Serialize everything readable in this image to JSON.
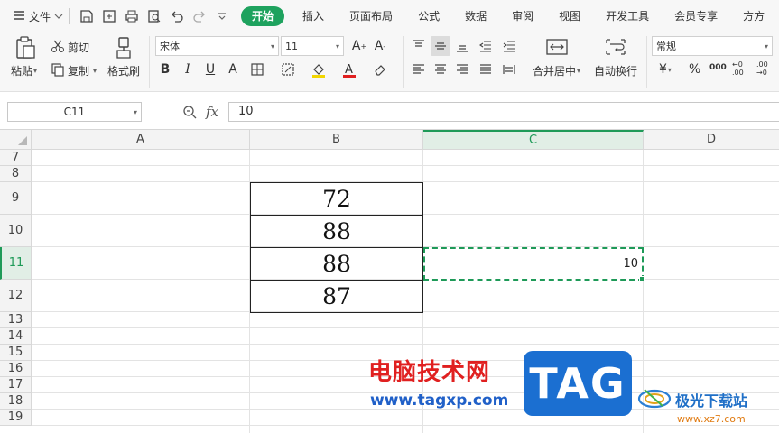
{
  "menubar": {
    "menu_label": "文件",
    "tabs": [
      {
        "label": "开始",
        "active": true
      },
      {
        "label": "插入"
      },
      {
        "label": "页面布局"
      },
      {
        "label": "公式"
      },
      {
        "label": "数据"
      },
      {
        "label": "审阅"
      },
      {
        "label": "视图"
      },
      {
        "label": "开发工具"
      },
      {
        "label": "会员专享"
      },
      {
        "label": "方方"
      }
    ]
  },
  "ribbon": {
    "paste": "粘贴",
    "cut": "剪切",
    "copy": "复制",
    "format_painter": "格式刷",
    "font_name": "宋体",
    "font_size": "11",
    "merge_center": "合并居中",
    "wrap_text": "自动换行",
    "number_format": "常规",
    "currency_symbol": "¥",
    "percent_symbol": "%",
    "thousands_symbol": "000",
    "inc_decimal": "←0 .00",
    "dec_decimal": ".00 →0"
  },
  "formula_bar": {
    "cell_ref": "C11",
    "fx_label": "fx",
    "formula_value": "10"
  },
  "grid": {
    "columns": [
      "A",
      "B",
      "C",
      "D"
    ],
    "selected_column": "C",
    "rows": [
      "7",
      "8",
      "9",
      "10",
      "11",
      "12",
      "13",
      "14",
      "15",
      "16",
      "17",
      "18",
      "19"
    ],
    "selected_row": "11",
    "b_values": [
      "72",
      "88",
      "88",
      "87"
    ],
    "active_cell_value": "10"
  },
  "watermark": {
    "site_name_cn": "电脑技术网",
    "site_url": "www.tagxp.com",
    "tag_text": "TAG",
    "logo_text": "极光下载站",
    "logo_url": "www.xz7.com"
  },
  "colors": {
    "accent": "#1ea25e",
    "watermark_red": "#e02020",
    "watermark_blue": "#1b6fd1"
  }
}
